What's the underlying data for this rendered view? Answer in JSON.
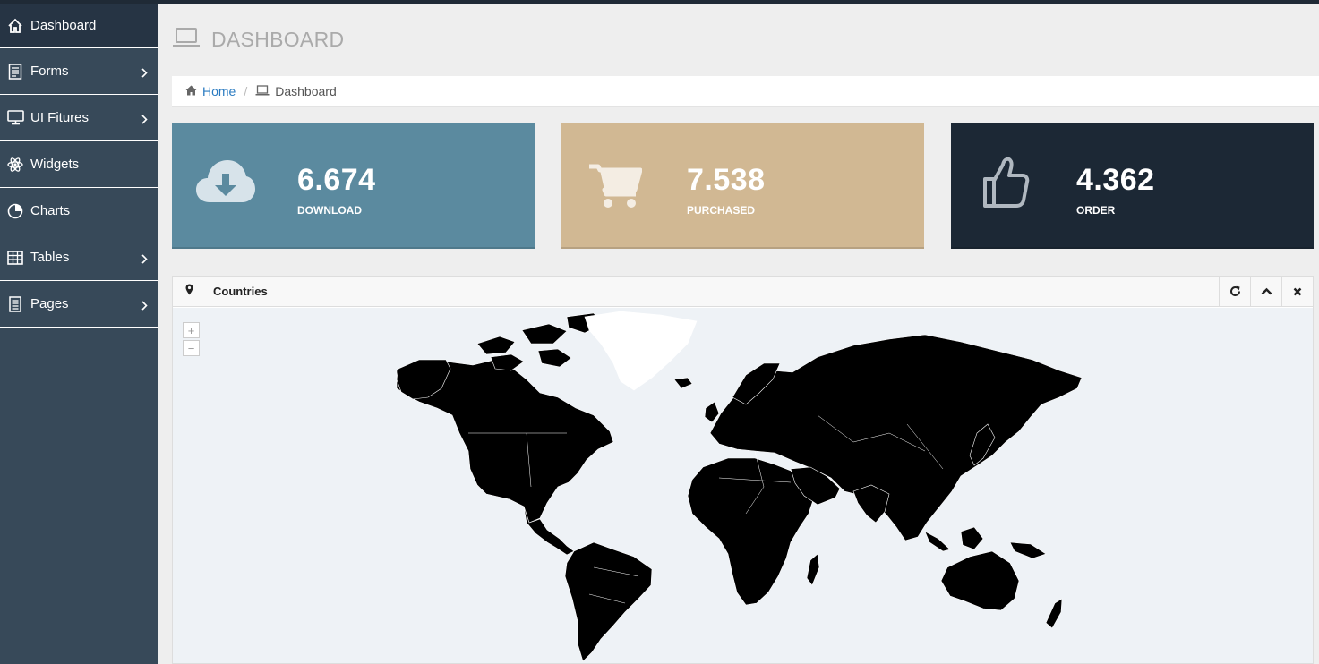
{
  "sidebar": {
    "items": [
      {
        "label": "Dashboard",
        "icon": "home-icon"
      },
      {
        "label": "Forms",
        "icon": "forms-icon"
      },
      {
        "label": "UI Fitures",
        "icon": "monitor-icon"
      },
      {
        "label": "Widgets",
        "icon": "atom-icon"
      },
      {
        "label": "Charts",
        "icon": "pie-chart-icon"
      },
      {
        "label": "Tables",
        "icon": "table-icon"
      },
      {
        "label": "Pages",
        "icon": "pages-icon"
      }
    ]
  },
  "header": {
    "title": "DASHBOARD",
    "icon": "laptop-icon"
  },
  "breadcrumb": {
    "home": "Home",
    "separator": "/",
    "current": "Dashboard"
  },
  "stats": [
    {
      "value": "6.674",
      "label": "DOWNLOAD",
      "icon": "cloud-download-icon",
      "color": "#5b8a9f"
    },
    {
      "value": "7.538",
      "label": "PURCHASED",
      "icon": "cart-icon",
      "color": "#d1b893"
    },
    {
      "value": "4.362",
      "label": "ORDER",
      "icon": "thumbs-up-icon",
      "color": "#1c2835"
    }
  ],
  "panel": {
    "title": "Countries",
    "zoom_in": "+",
    "zoom_out": "−"
  },
  "colors": {
    "sidebar": "#374959",
    "map_land": "#000000",
    "map_water": "#eef2f6",
    "link": "#2a7bc1"
  }
}
